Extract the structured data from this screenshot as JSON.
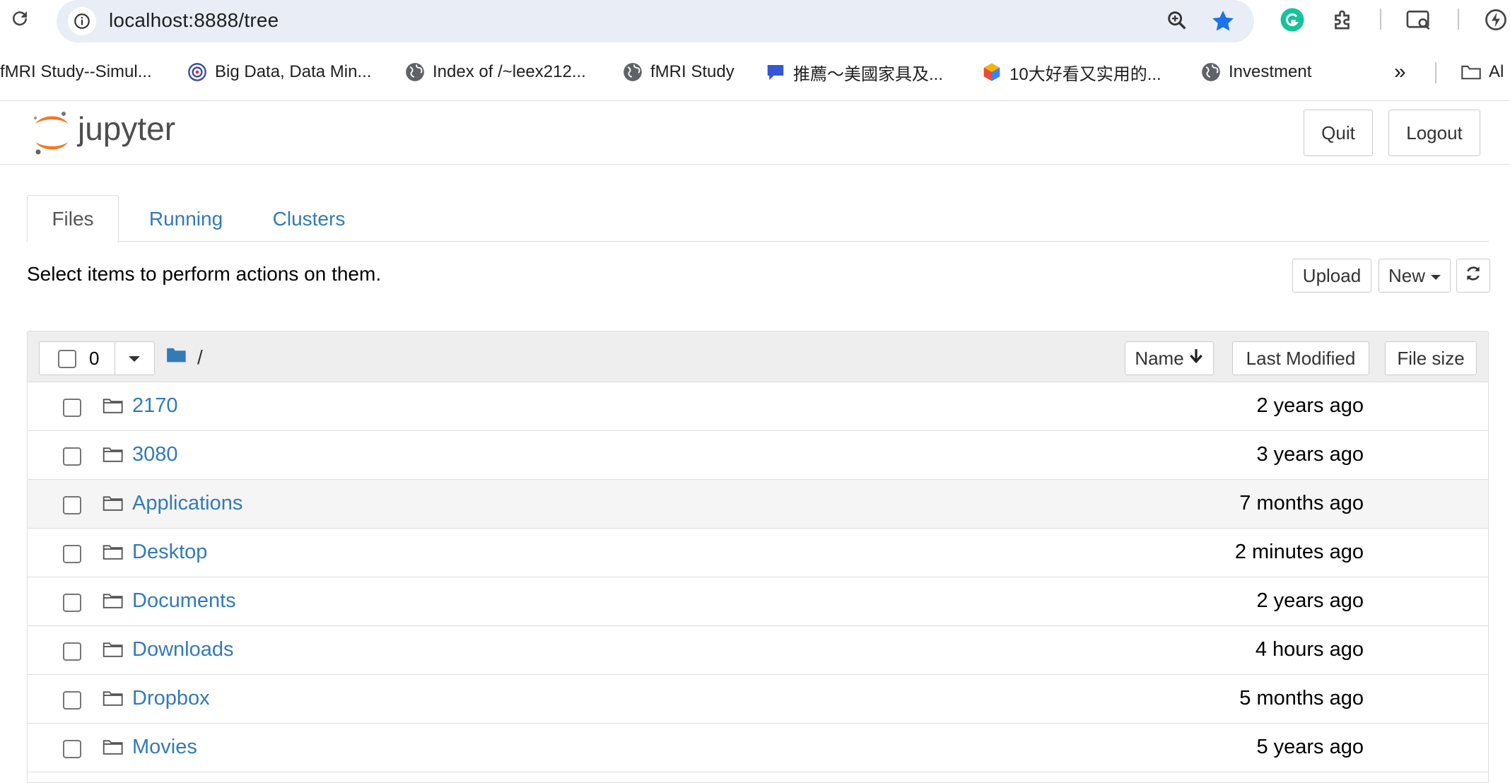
{
  "browser": {
    "url": "localhost:8888/tree",
    "bookmarks": [
      {
        "label": "fMRI Study--Simul...",
        "icon": "none"
      },
      {
        "label": "Big Data, Data Min...",
        "icon": "target-icon"
      },
      {
        "label": "Index of /~leex212...",
        "icon": "globe-icon"
      },
      {
        "label": "fMRI Study",
        "icon": "globe-icon"
      },
      {
        "label": "推薦～美國家具及...",
        "icon": "chat-bubble-icon"
      },
      {
        "label": "10大好看又实用的...",
        "icon": "cube-icon"
      },
      {
        "label": "Investment",
        "icon": "globe-icon"
      }
    ],
    "overflow_label": "»",
    "folder_label": "Al",
    "accent_color": "#1a73e8"
  },
  "header": {
    "logo_text": "jupyter",
    "quit_label": "Quit",
    "logout_label": "Logout"
  },
  "tabs": [
    {
      "label": "Files",
      "active": true
    },
    {
      "label": "Running",
      "active": false
    },
    {
      "label": "Clusters",
      "active": false
    }
  ],
  "toolbar": {
    "hint": "Select items to perform actions on them.",
    "upload_label": "Upload",
    "new_label": "New"
  },
  "list": {
    "selected_count": "0",
    "path": "/",
    "columns": {
      "name": "Name",
      "last_modified": "Last Modified",
      "file_size": "File size"
    },
    "items": [
      {
        "name": "2170",
        "modified": "2 years ago"
      },
      {
        "name": "3080",
        "modified": "3 years ago"
      },
      {
        "name": "Applications",
        "modified": "7 months ago"
      },
      {
        "name": "Desktop",
        "modified": "2 minutes ago"
      },
      {
        "name": "Documents",
        "modified": "2 years ago"
      },
      {
        "name": "Downloads",
        "modified": "4 hours ago"
      },
      {
        "name": "Dropbox",
        "modified": "5 months ago"
      },
      {
        "name": "Movies",
        "modified": "5 years ago"
      }
    ]
  }
}
